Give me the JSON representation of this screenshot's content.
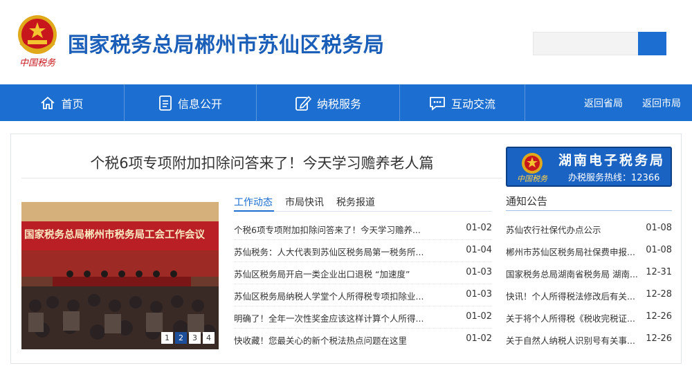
{
  "header": {
    "site_title": "国家税务总局郴州市苏仙区税务局",
    "emblem_caption": "中国税务",
    "search": {
      "value": "",
      "placeholder": ""
    }
  },
  "nav": {
    "items": [
      {
        "label": "首页",
        "icon": "home-icon"
      },
      {
        "label": "信息公开",
        "icon": "document-icon"
      },
      {
        "label": "纳税服务",
        "icon": "pencil-edit-icon"
      },
      {
        "label": "互动交流",
        "icon": "chat-bubble-icon"
      }
    ],
    "links": [
      {
        "label": "返回省局"
      },
      {
        "label": "返回市局"
      }
    ]
  },
  "headline": "个税6项专项附加扣除问答来了！今天学习赡养老人篇",
  "slideshow": {
    "banner_text": "国家税务总局郴州市税务局工会工作会议",
    "pages": [
      "1",
      "2",
      "3",
      "4"
    ],
    "active_page": "2"
  },
  "tabs": [
    {
      "label": "工作动态"
    },
    {
      "label": "市局快讯"
    },
    {
      "label": "税务报道"
    }
  ],
  "news": [
    {
      "title": "个税6项专项附加扣除问答来了！今天学习赡养...",
      "date": "01-02"
    },
    {
      "title": "苏仙税务：人大代表到苏仙区税务局第一税务所...",
      "date": "01-04"
    },
    {
      "title": "苏仙区税务局开启一类企业出口退税 “加速度”",
      "date": "01-03"
    },
    {
      "title": "苏仙区税务局纳税人学堂个人所得税专项扣除业...",
      "date": "01-03"
    },
    {
      "title": "明确了！全年一次性奖金应该这样计算个人所得...",
      "date": "01-02"
    },
    {
      "title": "快收藏！您最关心的新个税法热点问题在这里",
      "date": "01-02"
    }
  ],
  "banner": {
    "title": "湖南电子税务局",
    "subtitle": "办税服务热线：12366",
    "logo_caption": "中国税务"
  },
  "notices": {
    "title": "通知公告",
    "items": [
      {
        "title": "苏仙农行社保代办点公示",
        "date": "01-08"
      },
      {
        "title": "郴州市苏仙区税务局社保费申报...",
        "date": "01-08"
      },
      {
        "title": "国家税务总局湖南省税务局 湖南...",
        "date": "12-31"
      },
      {
        "title": "快讯！个人所得税法修改后有关...",
        "date": "12-28"
      },
      {
        "title": "关于将个人所得税《税收完税证...",
        "date": "12-26"
      },
      {
        "title": "关于自然人纳税人识别号有关事...",
        "date": "12-26"
      }
    ]
  },
  "colors": {
    "primary": "#1c6fd0",
    "title_blue": "#1c5fb8",
    "emblem_red": "#c8161d",
    "emblem_gold": "#e0a91b"
  }
}
